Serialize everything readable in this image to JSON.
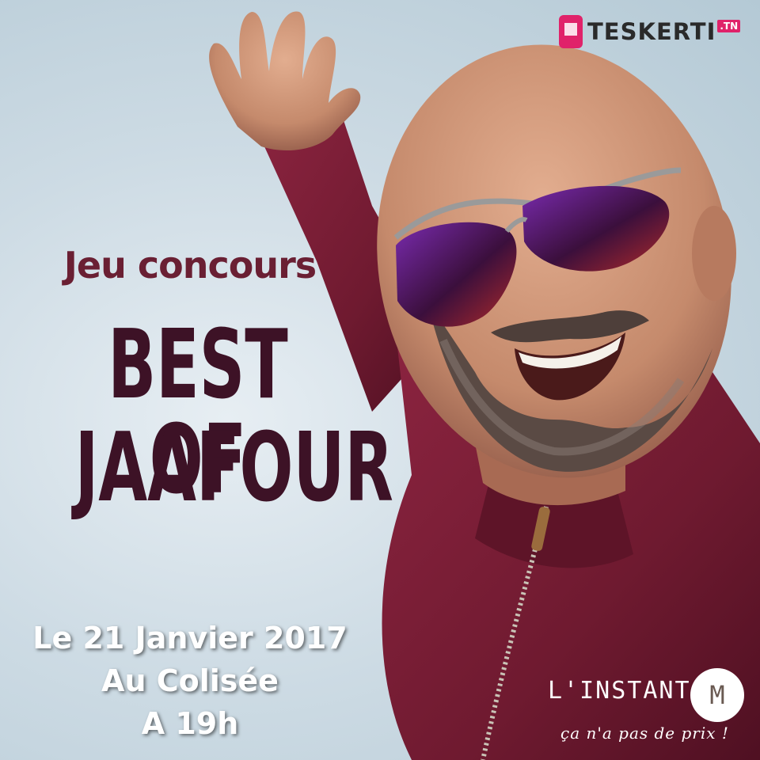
{
  "logo_top": {
    "brand": "TESKERTI",
    "suffix": ".TN"
  },
  "promo": {
    "subtitle": "Jeu concours",
    "title_line1": "BEST OF",
    "title_line2": "JAAFOUR",
    "date": "Le 21 Janvier 2017",
    "venue": "Au Colisée",
    "time": "A 19h"
  },
  "logo_bottom": {
    "name": "L'INSTANT",
    "letter": "M",
    "tagline": "ça n'a pas de prix !"
  },
  "colors": {
    "background": "#c6d6e0",
    "subtitle": "#6a1f33",
    "title": "#3d1226",
    "jacket": "#7a1e34",
    "accent": "#e0226a"
  }
}
